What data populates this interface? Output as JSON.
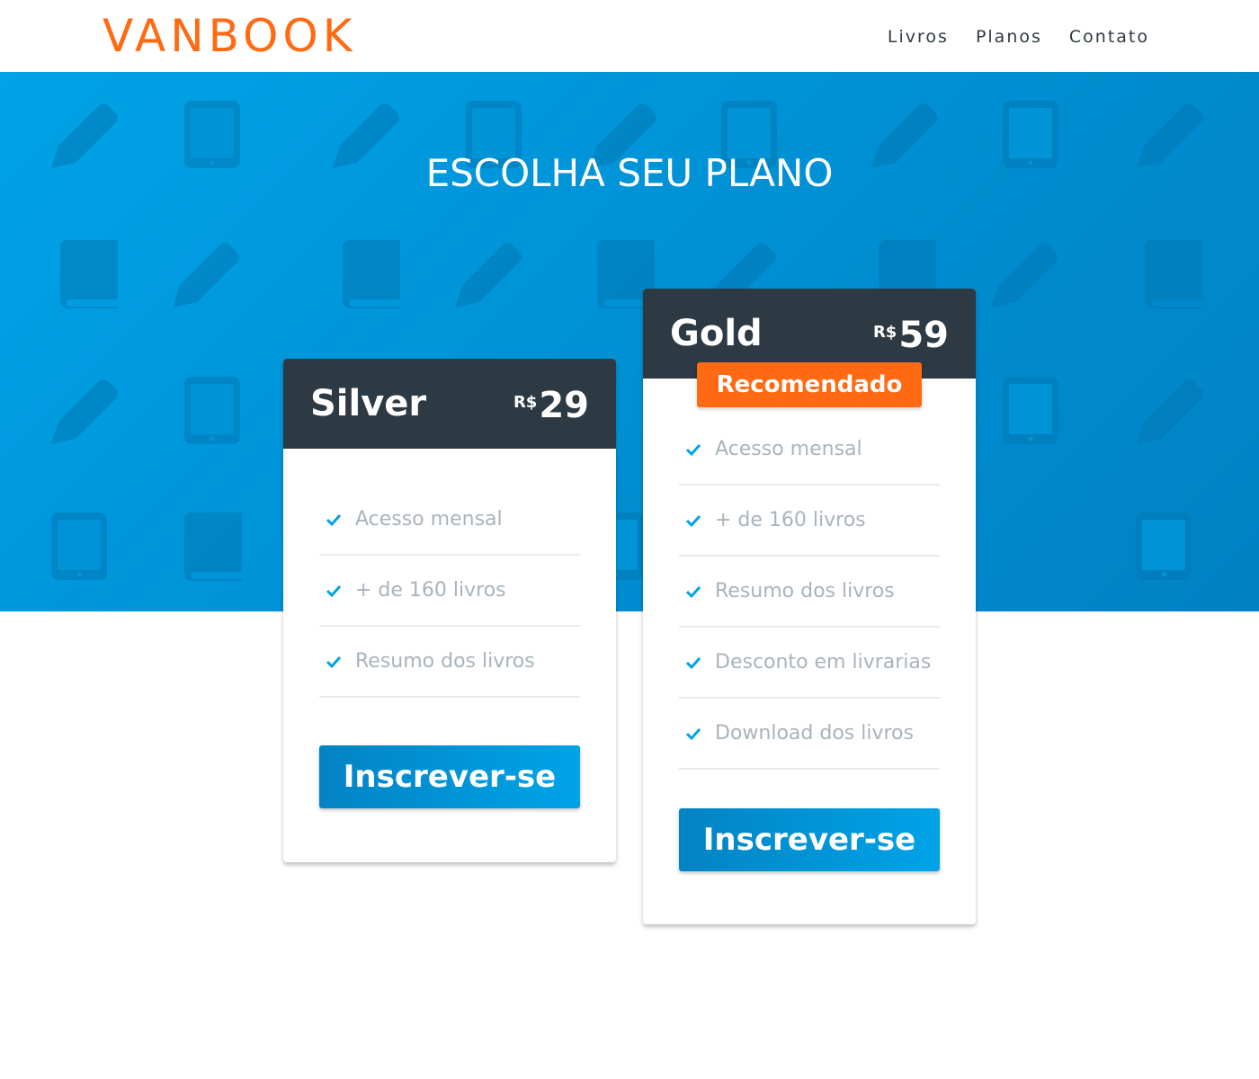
{
  "brand": {
    "logo": "VANBOOK",
    "accent": "#ff6a13",
    "dark": "#2d3943",
    "blue": "#00a3e8"
  },
  "nav": {
    "items": [
      "Livros",
      "Planos",
      "Contato"
    ]
  },
  "hero": {
    "title": "ESCOLHA SEU PLANO",
    "pattern_icons": [
      "pencil-icon",
      "tablet-icon",
      "book-icon"
    ]
  },
  "plans": [
    {
      "name": "Silver",
      "currency": "R$",
      "price": "29",
      "features": [
        "Acesso mensal",
        "+ de 160 livros",
        "Resumo dos livros"
      ],
      "button": "Inscrever-se"
    },
    {
      "name": "Gold",
      "currency": "R$",
      "price": "59",
      "badge": "Recomendado",
      "features": [
        "Acesso mensal",
        "+ de 160 livros",
        "Resumo dos livros",
        "Desconto em livrarias",
        "Download dos livros"
      ],
      "button": "Inscrever-se"
    }
  ]
}
